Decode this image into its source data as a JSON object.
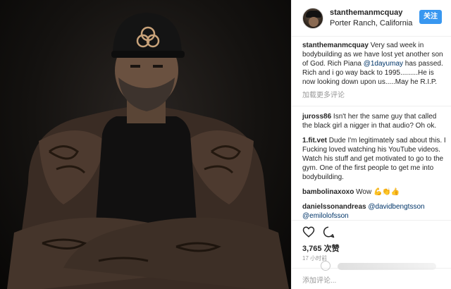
{
  "post": {
    "username": "stanthemanmcquay",
    "location": "Porter Ranch, California",
    "follow_label": "关注",
    "caption_text": " Very sad week in bodybuilding as we have lost yet another son of God. Rich Piana ",
    "caption_mention": "@1dayumay",
    "caption_tail": " has passed. Rich and i go way back to 1995.........He is now looking down upon us.....May he R.I.P.",
    "load_more": "加载更多评论",
    "likes": "3,765 次赞",
    "time": "17 小时前",
    "add_comment_placeholder": "添加评论..."
  },
  "comments": [
    {
      "user": "juross86",
      "text": " Isn't her the same guy that called the black girl a nigger in that audio? Oh ok."
    },
    {
      "user": "1.fit.vet",
      "text": " Dude I'm legitimately sad about this. I Fucking loved watching his YouTube videos. Watch his stuff and get motivated to go to the gym. One of the first people to get me into bodybuilding."
    },
    {
      "user": "bambolinaxoxo",
      "text": " Wow 💪👏👍"
    },
    {
      "user": "danielssonandreas",
      "mention1": "@davidbengtsson",
      "mention2": "@emilolofsson"
    }
  ],
  "icons": [
    "heart-icon",
    "comment-icon"
  ],
  "colors": {
    "accent": "#3897f0",
    "mention": "#003569",
    "muted": "#999999"
  }
}
